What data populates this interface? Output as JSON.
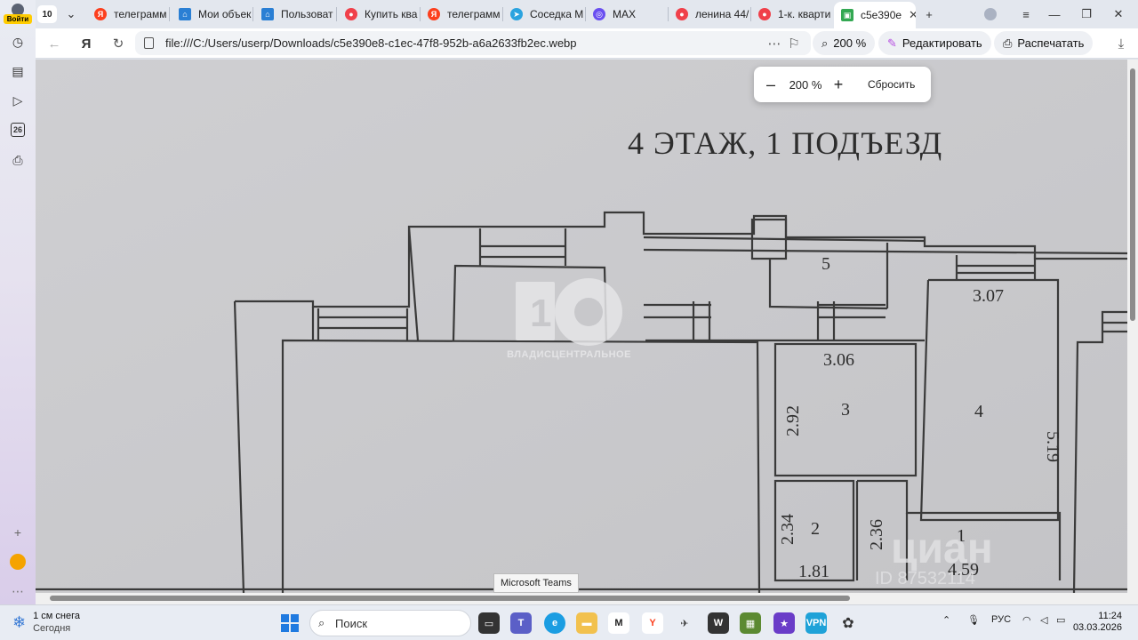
{
  "sidebar": {
    "login_label": "Войти",
    "calendar_day": "26"
  },
  "tabs": {
    "count": "10",
    "items": [
      {
        "label": "телеграмм",
        "icon": "yandex-icon",
        "color": "#fc3f1d"
      },
      {
        "label": "Мои объек",
        "icon": "house-icon",
        "color": "#2a7fd4"
      },
      {
        "label": "Пользоват",
        "icon": "house-icon",
        "color": "#2a7fd4"
      },
      {
        "label": "Купить ква",
        "icon": "cian-icon",
        "color": "#f0404a"
      },
      {
        "label": "телеграмм",
        "icon": "yandex-icon",
        "color": "#fc3f1d"
      },
      {
        "label": "Соседка М",
        "icon": "telegram-icon",
        "color": "#2aa3df"
      },
      {
        "label": "MAX",
        "icon": "max-icon",
        "color": "#6a4ff0"
      },
      {
        "label": "ленина 44/",
        "icon": "cian-icon",
        "color": "#f0404a"
      },
      {
        "label": "1-к. кварти",
        "icon": "cian-icon",
        "color": "#f0404a"
      },
      {
        "label": "c5e390e",
        "icon": "image-file-icon",
        "color": "#33a852"
      }
    ]
  },
  "addressbar": {
    "url": "file:///C:/Users/userp/Downloads/c5e390e8-c1ec-47f8-952b-a6a2633fb2ec.webp",
    "zoom_label": "200 %",
    "edit_label": "Редактировать",
    "print_label": "Распечатать"
  },
  "zoom_popup": {
    "minus": "–",
    "value": "200 %",
    "plus": "+",
    "reset_label": "Сбросить"
  },
  "image": {
    "heading": "4 ЭТАЖ, 1 ПОДЪЕЗД",
    "watermark_text": "ВЛАДИСЦЕНТРАЛЬНОЕ",
    "watermark_logo": "1",
    "cian_logo": "циан",
    "cian_id": "ID 87532114",
    "room_numbers": [
      "5",
      "3",
      "4",
      "2",
      "1"
    ],
    "dimensions": [
      "3.07",
      "3.06",
      "2.92",
      "5.19",
      "2.34",
      "2.36",
      "1.81",
      "4.59"
    ]
  },
  "tooltip": "Microsoft Teams",
  "taskbar": {
    "weather_line1": "1 см снега",
    "weather_line2": "Сегодня",
    "search_placeholder": "Поиск",
    "lang": "РУС",
    "time": "11:24",
    "date": "03.03.2026"
  }
}
